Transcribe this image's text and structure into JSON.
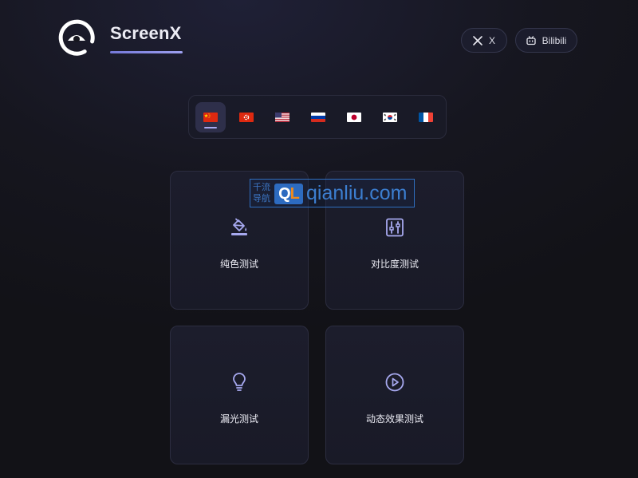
{
  "header": {
    "brand": "ScreenX",
    "logo_icon": "eye-logo-icon",
    "links": [
      {
        "label": "X",
        "icon": "x-logo-icon"
      },
      {
        "label": "Bilibili",
        "icon": "bilibili-tv-icon"
      }
    ]
  },
  "languages": {
    "active": "zh-CN",
    "items": [
      {
        "code": "zh-CN",
        "flag": "china-flag-icon"
      },
      {
        "code": "zh-HK",
        "flag": "hong-kong-flag-icon"
      },
      {
        "code": "en-US",
        "flag": "us-flag-icon"
      },
      {
        "code": "ru",
        "flag": "russia-flag-icon"
      },
      {
        "code": "ja",
        "flag": "japan-flag-icon"
      },
      {
        "code": "ko",
        "flag": "south-korea-flag-icon"
      },
      {
        "code": "fr",
        "flag": "france-flag-icon"
      }
    ]
  },
  "tests": [
    {
      "label": "纯色测试",
      "icon": "paint-bucket-icon"
    },
    {
      "label": "对比度测试",
      "icon": "sliders-icon"
    },
    {
      "label": "漏光测试",
      "icon": "lightbulb-icon"
    },
    {
      "label": "动态效果测试",
      "icon": "play-circle-icon"
    }
  ],
  "watermark": {
    "cn_text": "千流导航",
    "logo_text": "QL",
    "domain": "qianliu.com"
  },
  "colors": {
    "accent": "#a7a9ef",
    "background": "#16161f",
    "card": "#1c1d2c"
  }
}
